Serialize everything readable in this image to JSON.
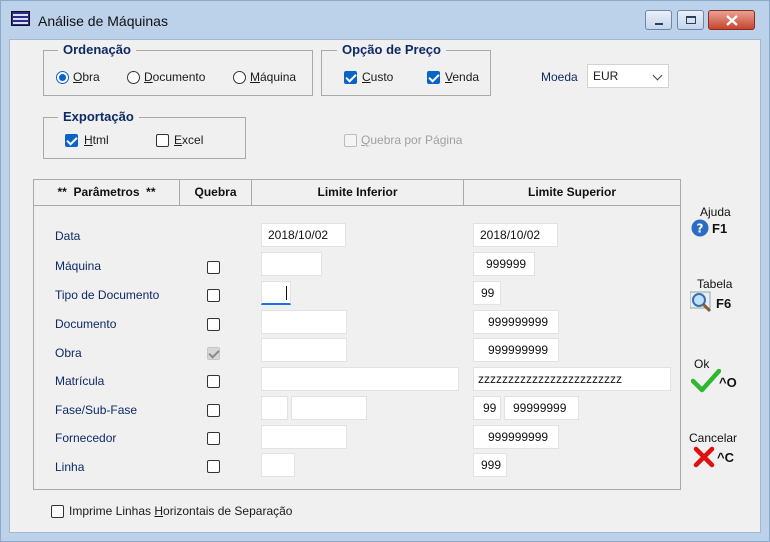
{
  "window": {
    "title": "Análise de Máquinas"
  },
  "ordenacao": {
    "label": "Ordenação",
    "options": [
      {
        "pre": "",
        "u": "O",
        "post": "bra",
        "selected": true
      },
      {
        "pre": "",
        "u": "D",
        "post": "ocumento",
        "selected": false
      },
      {
        "pre": "",
        "u": "M",
        "post": "áquina",
        "selected": false
      }
    ]
  },
  "preco": {
    "label": "Opção de Preço",
    "custo": {
      "pre": "",
      "u": "C",
      "post": "usto",
      "checked": true
    },
    "venda": {
      "pre": "",
      "u": "V",
      "post": "enda",
      "checked": true
    }
  },
  "moeda": {
    "label": "Moeda",
    "value": "EUR"
  },
  "exportacao": {
    "label": "Exportação",
    "html": {
      "pre": "",
      "u": "H",
      "post": "tml",
      "checked": true
    },
    "excel": {
      "pre": "",
      "u": "E",
      "post": "xcel",
      "checked": false
    }
  },
  "quebra_pagina": {
    "pre": "",
    "u": "Q",
    "post": "uebra por Página",
    "checked": false,
    "disabled": true
  },
  "table": {
    "headers": {
      "params": "**  Parâmetros  **",
      "quebra": "Quebra",
      "inferior": "Limite Inferior",
      "superior": "Limite Superior"
    },
    "rows": [
      {
        "label": "Data",
        "quebra": null,
        "inf": "2018/10/02",
        "sup": "2018/10/02"
      },
      {
        "label": "Máquina",
        "quebra": false,
        "inf": "",
        "sup": "999999"
      },
      {
        "label": "Tipo de Documento",
        "quebra": false,
        "inf": "",
        "sup": "99"
      },
      {
        "label": "Documento",
        "quebra": false,
        "inf": "",
        "sup": "999999999"
      },
      {
        "label": "Obra",
        "quebra": "disabled-checked",
        "inf": "",
        "sup": "999999999"
      },
      {
        "label": "Matrícula",
        "quebra": false,
        "inf": "",
        "sup": "zzzzzzzzzzzzzzzzzzzzzzzz"
      },
      {
        "label": "Fase/Sub-Fase",
        "quebra": false,
        "inf_a": "",
        "inf_b": "",
        "sup_a": "99",
        "sup_b": "99999999"
      },
      {
        "label": "Fornecedor",
        "quebra": false,
        "inf": "",
        "sup": "999999999"
      },
      {
        "label": "Linha",
        "quebra": false,
        "inf": "",
        "sup": "999"
      }
    ]
  },
  "imprime_linhas": {
    "pre": "Imprime Linhas ",
    "u": "H",
    "post": "orizontais de Separação",
    "checked": false
  },
  "side_buttons": {
    "ajuda": {
      "label": "Ajuda",
      "key": "F1"
    },
    "tabela": {
      "label": "Tabela",
      "key": "F6"
    },
    "ok": {
      "label": "Ok",
      "key": "^O"
    },
    "cancelar": {
      "label": "Cancelar",
      "key": "^C"
    }
  },
  "colors": {
    "accent": "#0a64c8",
    "group_label": "#0d2a64",
    "ok": "#2eb82e",
    "cancel": "#e01010",
    "help": "#2b6cc4"
  }
}
